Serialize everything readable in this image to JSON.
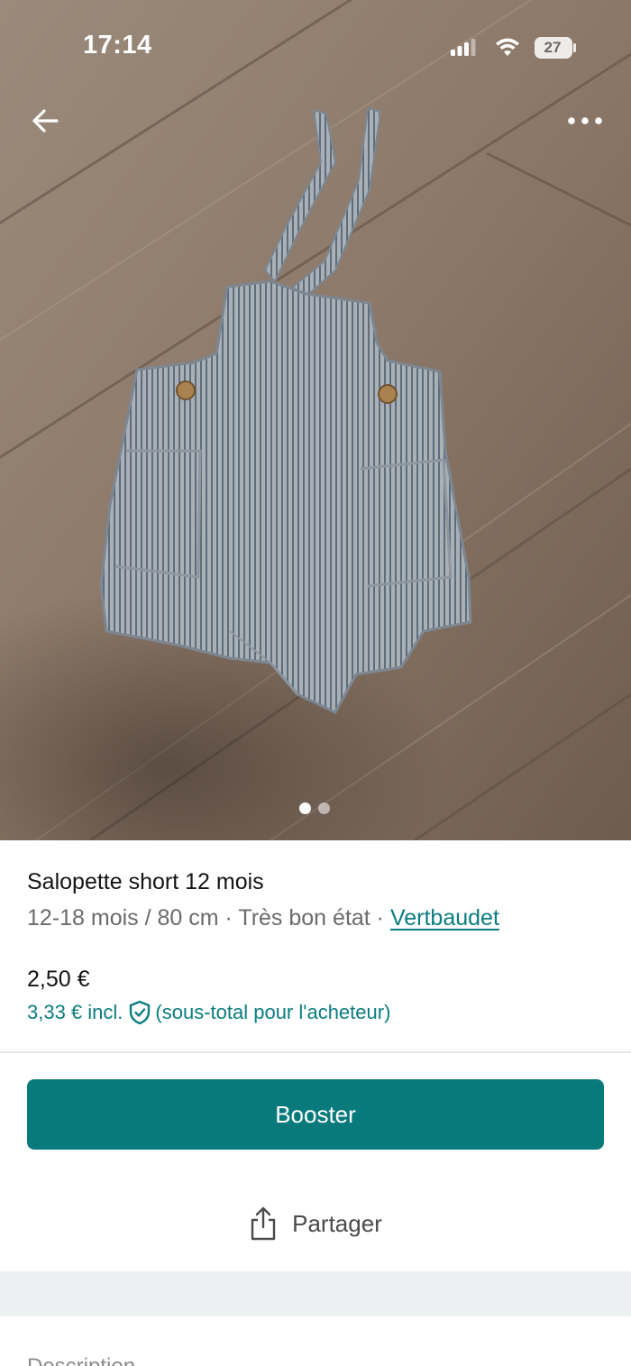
{
  "status_bar": {
    "time": "17:14",
    "battery_level": "27",
    "icons": [
      "signal-icon",
      "wifi-icon",
      "battery-icon"
    ]
  },
  "nav": {
    "back_icon": "arrow-left-icon",
    "more_icon": "more-horizontal-icon"
  },
  "gallery": {
    "image_count": 2,
    "active_index": 0
  },
  "item": {
    "title": "Salopette short 12 mois",
    "size": "12-18 mois / 80 cm",
    "separator": " · ",
    "condition": "Très bon état",
    "brand": "Vertbaudet",
    "price": "2,50 €",
    "buyer_price": "3,33 € incl.",
    "buyer_price_note": "(sous-total pour l'acheteur)"
  },
  "actions": {
    "booster_label": "Booster",
    "share_label": "Partager",
    "share_icon": "share-icon"
  },
  "sections": {
    "description_title": "Description"
  },
  "colors": {
    "accent": "#097a7c",
    "link": "#0a7d80",
    "text_primary": "#141414",
    "text_secondary": "#6b6b6b",
    "band": "#edf0f0"
  }
}
